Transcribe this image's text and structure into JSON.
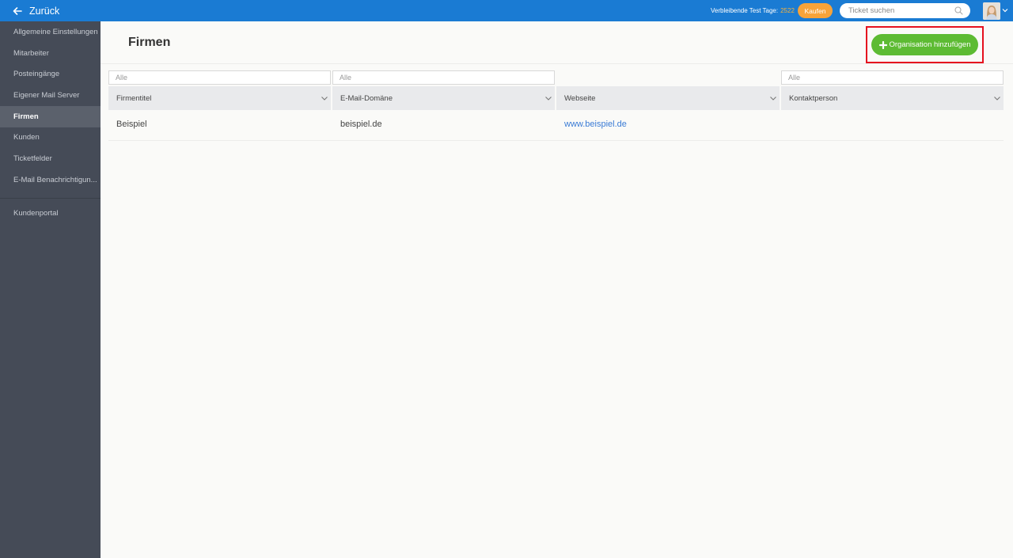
{
  "topbar": {
    "back_label": "Zurück",
    "trial_label": "Verbleibende Test Tage:",
    "trial_days": "2522",
    "buy_label": "Kaufen",
    "search_placeholder": "Ticket suchen",
    "brand_color": "#1a7bd3"
  },
  "sidebar": {
    "items": [
      {
        "label": "Allgemeine Einstellungen"
      },
      {
        "label": "Mitarbeiter"
      },
      {
        "label": "Posteingänge"
      },
      {
        "label": "Eigener Mail Server"
      },
      {
        "label": "Firmen",
        "active": true
      },
      {
        "label": "Kunden"
      },
      {
        "label": "Ticketfelder"
      },
      {
        "label": "E-Mail Benachrichtigun..."
      },
      {
        "label": "Kundenportal"
      }
    ]
  },
  "main": {
    "title": "Firmen",
    "add_button_label": "Organisation hinzufügen",
    "add_button_color": "#5dbb33",
    "highlight_color": "#e5101f"
  },
  "table": {
    "filters": [
      "Alle",
      "Alle",
      "Alle"
    ],
    "columns": [
      "Firmentitel",
      "E-Mail-Domäne",
      "Webseite",
      "Kontaktperson"
    ],
    "rows": [
      {
        "company": "Beispiel",
        "domain": "beispiel.de",
        "website": "www.beispiel.de",
        "contact": ""
      }
    ]
  }
}
